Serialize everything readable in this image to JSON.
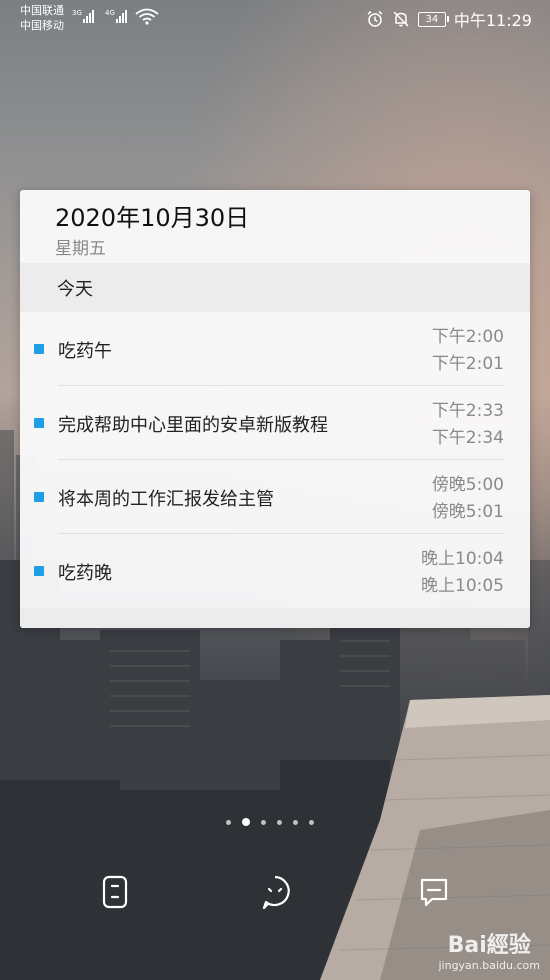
{
  "status_bar": {
    "carrier_1": "中国联通",
    "carrier_2": "中国移动",
    "network_1": "3G",
    "network_2": "4G",
    "battery": "34",
    "time": "中午11:29"
  },
  "widget": {
    "date": "2020年10月30日",
    "weekday": "星期五",
    "section_label": "今天",
    "events": [
      {
        "title": "吃药午",
        "start": "下午2:00",
        "end": "下午2:01"
      },
      {
        "title": "完成帮助中心里面的安卓新版教程",
        "start": "下午2:33",
        "end": "下午2:34"
      },
      {
        "title": "将本周的工作汇报发给主管",
        "start": "傍晚5:00",
        "end": "傍晚5:01"
      },
      {
        "title": "吃药晚",
        "start": "晚上10:04",
        "end": "晚上10:05"
      }
    ],
    "bullet_color": "#1e9ee6"
  },
  "page_indicator": {
    "count": 6,
    "active_index": 1
  },
  "shortcuts": [
    {
      "icon": "assistant-icon"
    },
    {
      "icon": "smart-face-icon"
    },
    {
      "icon": "message-icon"
    }
  ],
  "watermark": {
    "logo": "Bai經验",
    "url": "jingyan.baidu.com"
  }
}
